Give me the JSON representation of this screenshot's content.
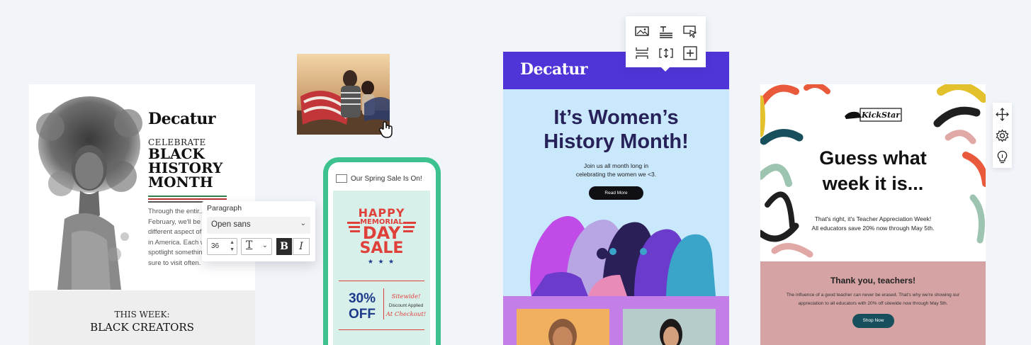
{
  "card1": {
    "logo": "Decatur",
    "celebrate": "CELEBRATE",
    "headline_lines": [
      "BLACK",
      "HISTORY",
      "MONTH"
    ],
    "body_lines": [
      "Through the entir...",
      "February, we'll be fe...",
      "different aspect of B...",
      "in America. Each we...",
      "spotlight something...",
      "sure to visit often."
    ],
    "footer_label": "THIS WEEK:",
    "footer_title": "BLACK CREATORS"
  },
  "paragraph_toolbar": {
    "label": "Paragraph",
    "font": "Open sans",
    "size": "36",
    "bold_label": "B",
    "italic_label": "I",
    "text_color_glyph": "T"
  },
  "phone": {
    "subject": "Our Spring Sale Is On!",
    "happy": "HAPPY",
    "memorial": "MEMORIAL",
    "day": "DAY",
    "sale": "SALE",
    "stars": "★ ★ ★",
    "percent_line1": "30%",
    "percent_line2": "OFF",
    "sitewide": "Sitewide!",
    "discount": "Discount Applied",
    "checkout": "At Checkout!"
  },
  "card3": {
    "logo": "Decatur",
    "title_lines": [
      "It’s Women’s",
      "History Month!"
    ],
    "sub_lines": [
      "Join us all month long in",
      "celebrating the women we <3."
    ],
    "button": "Read More"
  },
  "card4": {
    "brand": "KickStar",
    "title_lines": [
      "Guess what",
      "week it is..."
    ],
    "sub_lines": [
      "That's right, it's Teacher Appreciation Week!",
      "All educators save 20% now through May 5th."
    ],
    "thanks": "Thank you, teachers!",
    "para_lines": [
      "The influence of a good teacher can never be erased. That's why we're showing our",
      "appreciation to all educators with 20% off sitewide now through May 5th."
    ],
    "button": "Shop Now"
  },
  "colors": {
    "background": "#f1f4f8",
    "decatur_purple": "#4f34d8",
    "phone_green": "#3cc18f",
    "sale_red": "#e0403a",
    "navy": "#1e3a8a",
    "teacher_pink": "#d5a3a3",
    "shop_teal": "#17505c"
  },
  "icons": {
    "block_toolbar": [
      "image-icon",
      "text-block-icon",
      "button-cursor-icon",
      "divider-icon",
      "spacer-icon",
      "add-block-icon"
    ],
    "side_toolbar": [
      "move-icon",
      "settings-icon",
      "bulb-icon"
    ],
    "cursor": "hand-cursor-icon"
  }
}
